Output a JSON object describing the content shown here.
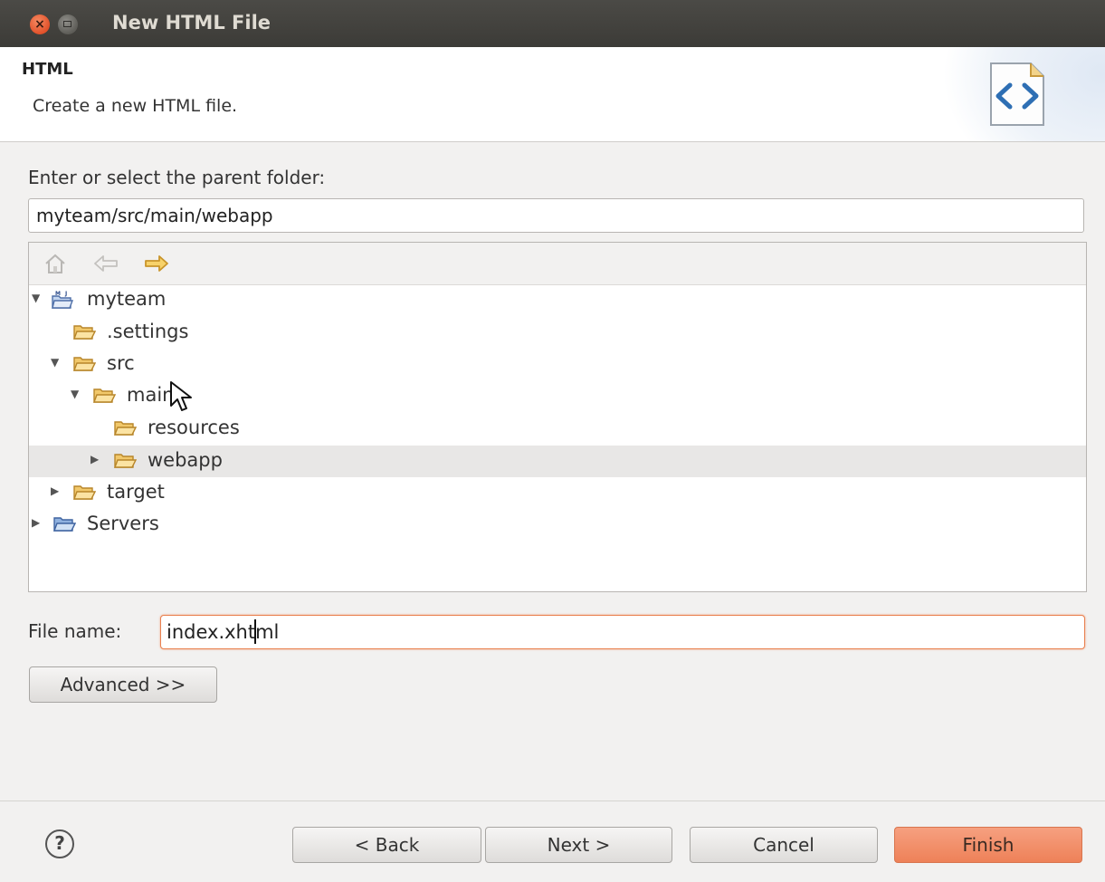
{
  "window": {
    "title": "New HTML File"
  },
  "banner": {
    "title": "HTML",
    "description": "Create a new HTML file."
  },
  "folder": {
    "label": "Enter or select the parent folder:",
    "path": "myteam/src/main/webapp"
  },
  "tree": [
    {
      "label": "myteam",
      "expanded": true,
      "icon": "project-folder-icon"
    },
    {
      "label": ".settings",
      "icon": "folder-icon"
    },
    {
      "label": "src",
      "expanded": true,
      "icon": "folder-icon"
    },
    {
      "label": "main",
      "expanded": true,
      "icon": "folder-icon"
    },
    {
      "label": "resources",
      "icon": "folder-icon"
    },
    {
      "label": "webapp",
      "expanded": false,
      "selected": true,
      "icon": "folder-icon"
    },
    {
      "label": "target",
      "expanded": false,
      "icon": "folder-icon"
    },
    {
      "label": "Servers",
      "expanded": false,
      "icon": "servers-folder-icon"
    }
  ],
  "filename": {
    "label": "File name:",
    "value": "index.xhtml"
  },
  "buttons": {
    "advanced": "Advanced >>",
    "back": "< Back",
    "next": "Next >",
    "cancel": "Cancel",
    "finish": "Finish"
  },
  "colors": {
    "accent": "#ee8158",
    "titlebar": "#3c3b37",
    "selection": "#e8e7e6"
  }
}
